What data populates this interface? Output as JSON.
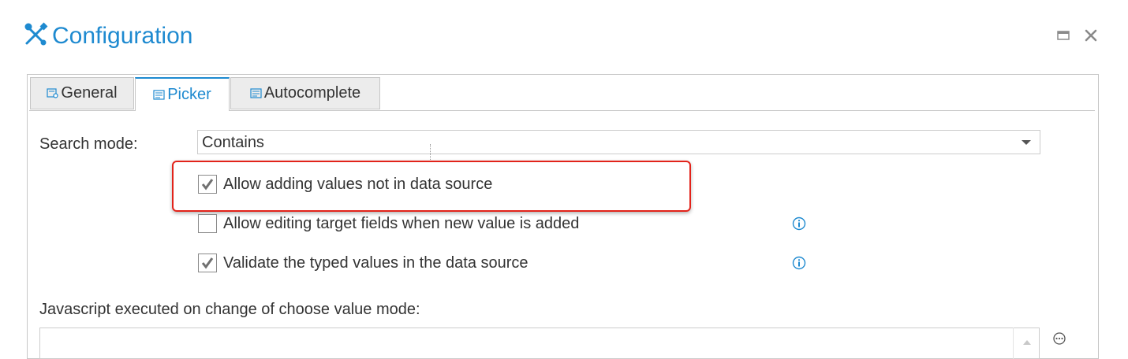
{
  "window": {
    "title": "Configuration",
    "accent_color": "#1e8ad0",
    "controls": [
      {
        "name": "maximize-icon"
      },
      {
        "name": "close-icon"
      }
    ]
  },
  "tabs": [
    {
      "label": "General",
      "icon": "settings-page-icon",
      "active": false
    },
    {
      "label": "Picker",
      "icon": "list-form-icon",
      "active": true
    },
    {
      "label": "Autocomplete",
      "icon": "list-form-icon",
      "active": false
    }
  ],
  "picker": {
    "search_mode_label": "Search mode:",
    "search_mode_value": "Contains",
    "options": [
      {
        "label": "Allow adding values not in data source",
        "checked": true,
        "info": false,
        "highlighted": true
      },
      {
        "label": "Allow editing target fields when new value is added",
        "checked": false,
        "info": true
      },
      {
        "label": "Validate the typed values in the data source",
        "checked": true,
        "info": true
      }
    ],
    "js_label": "Javascript executed on change of choose value mode:",
    "js_value": ""
  },
  "colors": {
    "highlight_border": "#e2231a",
    "panel_border": "#c6c6c6",
    "tab_inactive_bg": "#ececec"
  }
}
